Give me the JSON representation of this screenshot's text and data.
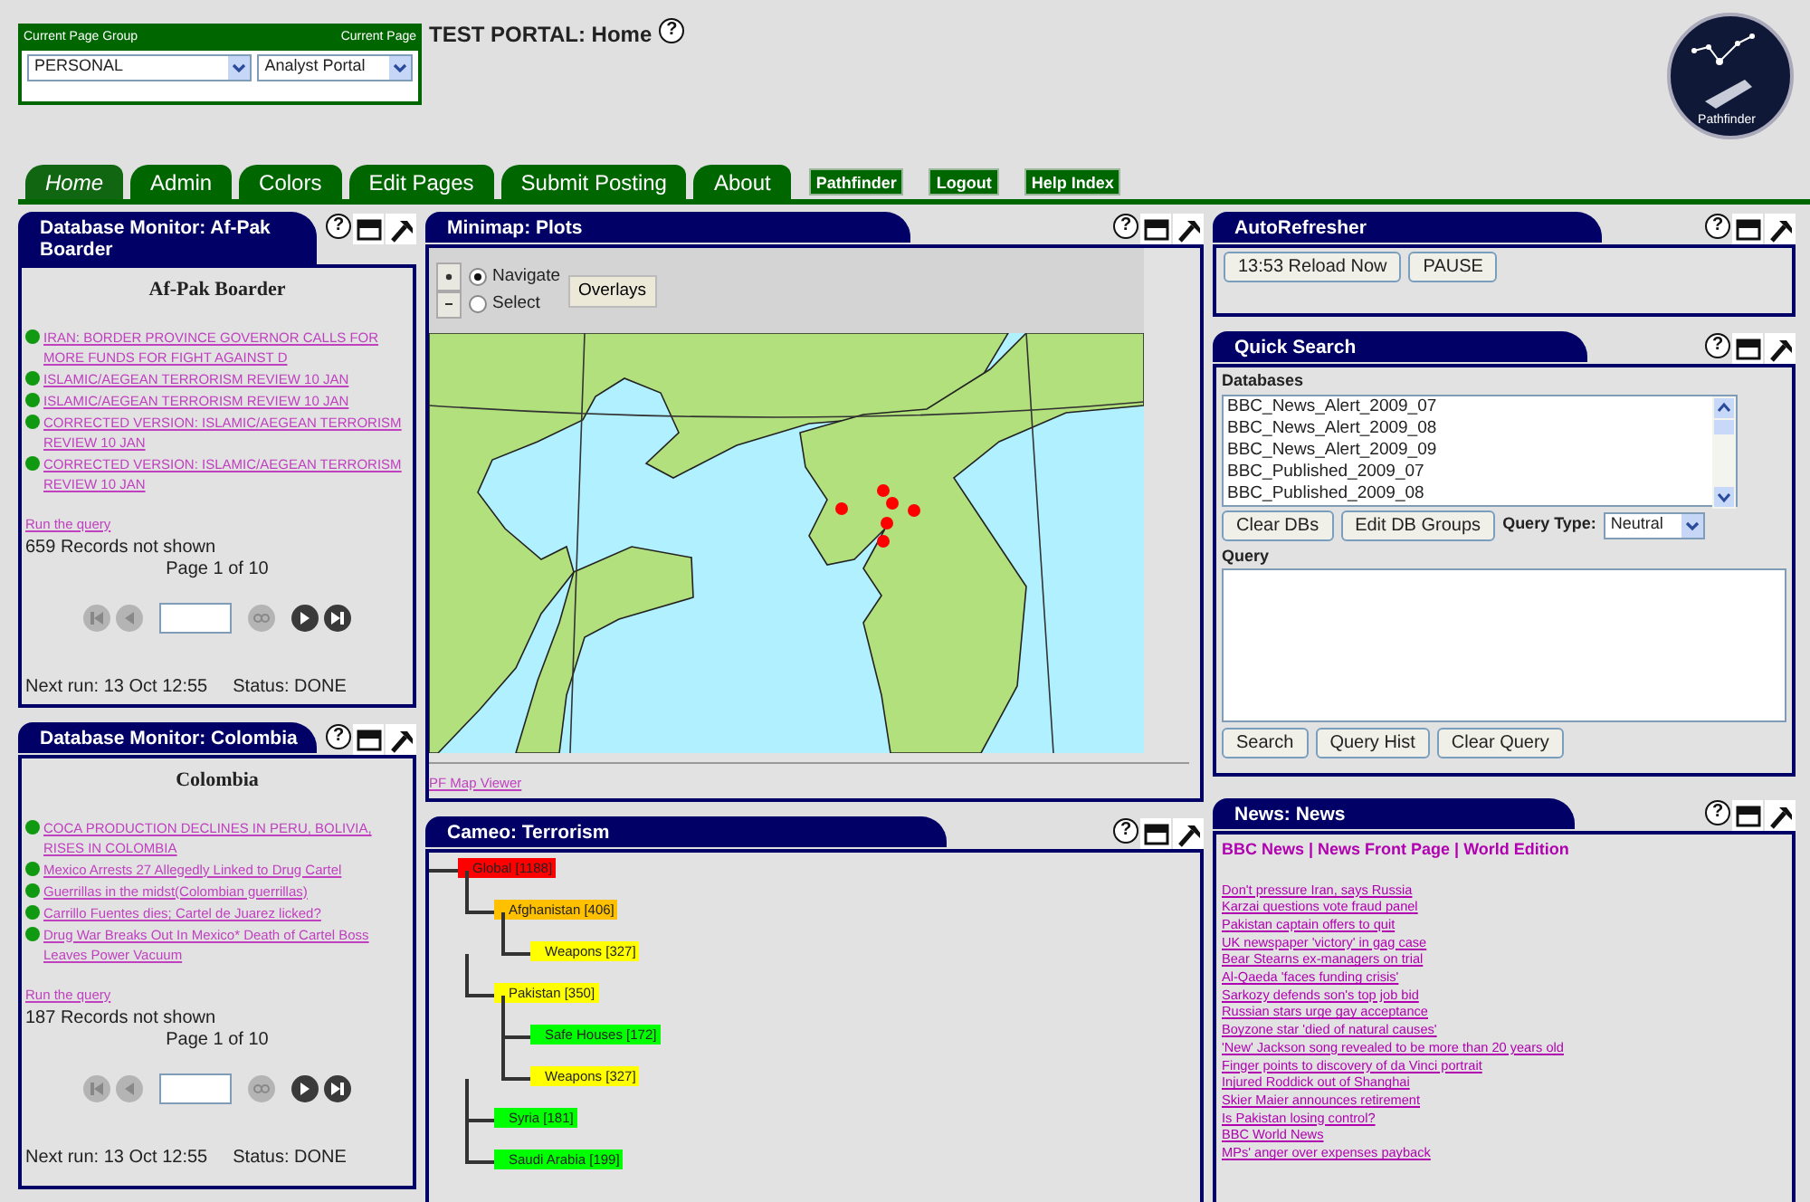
{
  "page_selector": {
    "group_label": "Current Page Group",
    "page_label": "Current Page",
    "group_value": "PERSONAL",
    "page_value": "Analyst Portal"
  },
  "portal_title": "TEST PORTAL: Home",
  "portal_help": "?",
  "logo": {
    "text": "Pathfinder"
  },
  "tabs": [
    {
      "label": "Home",
      "selected": true,
      "kind": "tab"
    },
    {
      "label": "Admin",
      "selected": false,
      "kind": "tab"
    },
    {
      "label": "Colors",
      "selected": false,
      "kind": "tab"
    },
    {
      "label": "Edit Pages",
      "selected": false,
      "kind": "tab"
    },
    {
      "label": "Submit Posting",
      "selected": false,
      "kind": "tab"
    },
    {
      "label": "About",
      "selected": false,
      "kind": "tab"
    },
    {
      "label": "Pathfinder",
      "kind": "link"
    },
    {
      "label": "Logout",
      "kind": "link"
    },
    {
      "label": "Help Index",
      "kind": "link"
    }
  ],
  "monitors": [
    {
      "title": "Database Monitor: Af-Pak Boarder",
      "help": "?",
      "heading": "Af-Pak Boarder",
      "items": [
        "IRAN: BORDER PROVINCE GOVERNOR CALLS FOR MORE FUNDS FOR FIGHT AGAINST D",
        "ISLAMIC/AEGEAN TERRORISM REVIEW 10 JAN",
        "ISLAMIC/AEGEAN TERRORISM REVIEW 10 JAN",
        "CORRECTED VERSION: ISLAMIC/AEGEAN TERRORISM REVIEW 10 JAN",
        "CORRECTED VERSION: ISLAMIC/AEGEAN TERRORISM REVIEW 10 JAN"
      ],
      "run_link": "Run the query",
      "records": "659 Records not shown",
      "page": "Page 1 of 10",
      "pager": [
        {
          "kind": "first",
          "disabled": true
        },
        {
          "kind": "prev",
          "disabled": true
        },
        {
          "kind": "go",
          "disabled": true
        },
        {
          "kind": "next",
          "disabled": false
        },
        {
          "kind": "last",
          "disabled": false
        }
      ],
      "next_run": "Next run: 13 Oct 12:55",
      "status": "Status: DONE"
    },
    {
      "title": "Database Monitor: Colombia",
      "help": "?",
      "heading": "Colombia",
      "items": [
        "COCA PRODUCTION DECLINES IN PERU, BOLIVIA, RISES IN COLOMBIA",
        "Mexico Arrests 27 Allegedly Linked to Drug Cartel",
        "Guerrillas in the midst(Colombian guerrillas)",
        "Carrillo Fuentes dies; Cartel de Juarez licked?",
        "Drug War Breaks Out In Mexico* Death of Cartel Boss Leaves Power Vacuum"
      ],
      "run_link": "Run the query",
      "records": "187 Records not shown",
      "page": "Page 1 of 10",
      "pager": [
        {
          "kind": "first",
          "disabled": true
        },
        {
          "kind": "prev",
          "disabled": true
        },
        {
          "kind": "go",
          "disabled": true
        },
        {
          "kind": "next",
          "disabled": false
        },
        {
          "kind": "last",
          "disabled": false
        }
      ],
      "next_run": "Next run: 13 Oct 12:55",
      "status": "Status: DONE"
    }
  ],
  "minimap": {
    "title": "Minimap: Plots",
    "help": "?",
    "modes": [
      {
        "label": "Navigate",
        "selected": true
      },
      {
        "label": "Select",
        "selected": false
      }
    ],
    "overlays_button": "Overlays",
    "footer_link": "PF Map Viewer"
  },
  "cameo": {
    "title": "Cameo: Terrorism",
    "help": "?",
    "tree": [
      {
        "label": "Global [1188]",
        "color": "#ff0000",
        "children": [
          {
            "label": "Afghanistan [406]",
            "color": "#ffc000",
            "children": [
              {
                "label": "Weapons [327]",
                "color": "#ffff00"
              }
            ]
          },
          {
            "label": "Pakistan [350]",
            "color": "#ffff00",
            "children": [
              {
                "label": "Safe Houses [172]",
                "color": "#00ff00"
              },
              {
                "label": "Weapons [327]",
                "color": "#ffff00"
              }
            ]
          },
          {
            "label": "Syria [181]",
            "color": "#00ff00"
          },
          {
            "label": "Saudi Arabia [199]",
            "color": "#00ff00"
          }
        ]
      }
    ]
  },
  "autorefresher": {
    "title": "AutoRefresher",
    "help": "?",
    "buttons": [
      "13:53 Reload Now",
      "PAUSE"
    ]
  },
  "quick_search": {
    "title": "Quick Search",
    "help": "?",
    "databases_label": "Databases",
    "databases": [
      "BBC_News_Alert_2009_07",
      "BBC_News_Alert_2009_08",
      "BBC_News_Alert_2009_09",
      "BBC_Published_2009_07",
      "BBC_Published_2009_08"
    ],
    "db_buttons": [
      "Clear DBs",
      "Edit DB Groups"
    ],
    "query_type_label": "Query Type:",
    "query_type_value": "Neutral",
    "query_label": "Query",
    "query_buttons": [
      "Search",
      "Query Hist",
      "Clear Query"
    ]
  },
  "news": {
    "title": "News: News",
    "help": "?",
    "header": "BBC News | News Front Page | World Edition",
    "items": [
      "Don't pressure Iran, says Russia",
      "Karzai questions vote fraud panel",
      "Pakistan captain offers to quit",
      "UK newspaper 'victory' in gag case",
      "Bear Stearns ex-managers on trial",
      "Al-Qaeda 'faces funding crisis'",
      "Sarkozy defends son's top job bid",
      "Russian stars urge gay acceptance",
      "Boyzone star 'died of natural causes'",
      "'New' Jackson song revealed to be more than 20 years old",
      "Finger points to discovery of da Vinci portrait",
      "Injured Roddick out of Shanghai",
      "Skier Maier announces retirement",
      "Is Pakistan losing control?",
      "BBC World News",
      "MPs' anger over expenses payback"
    ]
  }
}
